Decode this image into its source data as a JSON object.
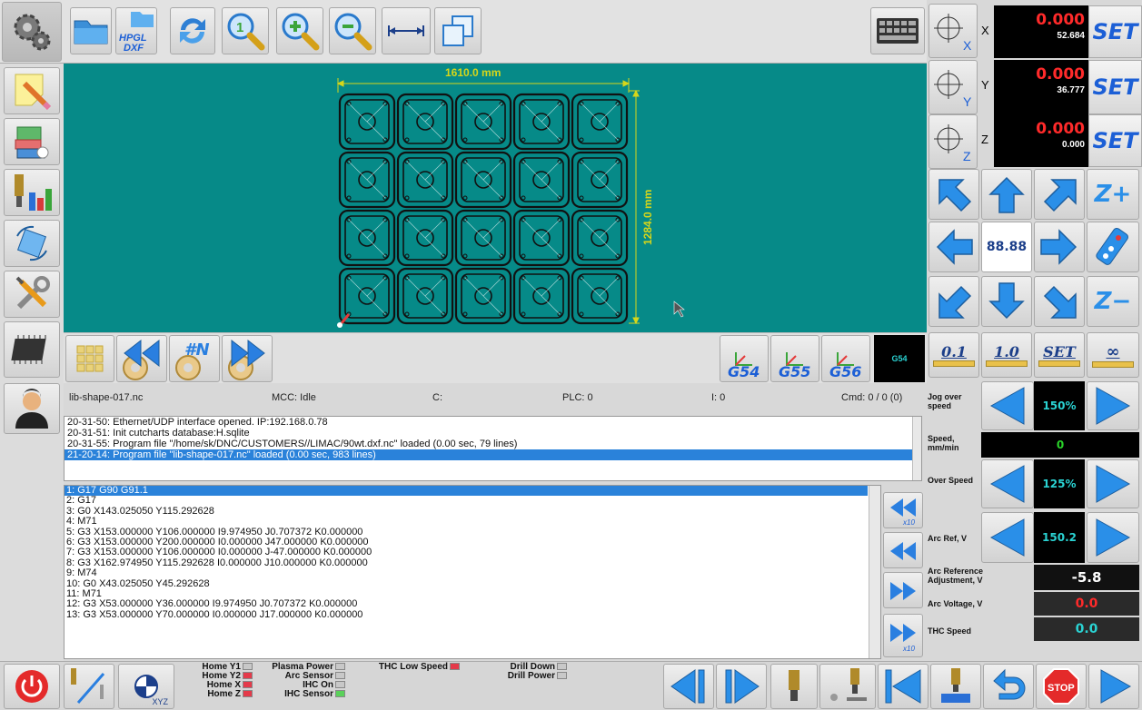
{
  "canvas": {
    "width_dim": "1610.0 mm",
    "height_dim": "1284.0 mm",
    "bg": "#068a88"
  },
  "toolbar": {
    "hpgl_label": "HPGL\nDXF"
  },
  "coords": {
    "active_wcs": "G54",
    "wcs_buttons": [
      "G54",
      "G55",
      "G56"
    ],
    "jump_label": "#N"
  },
  "status": {
    "file": "lib-shape-017.nc",
    "mcc": "MCC: Idle",
    "c": "C:",
    "plc": "PLC: 0",
    "i": "I: 0",
    "cmd": "Cmd: 0 / 0 (0)"
  },
  "log": [
    "20-31-50: Ethernet/UDP interface opened. IP:192.168.0.78",
    "20-31-51: Init cutcharts database:H.sqlite",
    "20-31-55: Program file \"/home/sk/DNC/CUSTOMERS//LIMAC/90wt.dxf.nc\" loaded (0.00 sec, 79 lines)",
    "21-20-14: Program file \"lib-shape-017.nc\" loaded (0.00 sec, 983 lines)"
  ],
  "code": [
    "1: G17 G90 G91.1",
    "2: G17",
    "3: G0 X143.025050 Y115.292628",
    "4: M71",
    "5: G3 X153.000000 Y106.000000 I9.974950 J0.707372 K0.000000",
    "6: G3 X153.000000 Y200.000000 I0.000000 J47.000000 K0.000000",
    "7: G3 X153.000000 Y106.000000 I0.000000 J-47.000000 K0.000000",
    "8: G3 X162.974950 Y115.292628 I0.000000 J10.000000 K0.000000",
    "9: M74",
    "10: G0 X43.025050 Y45.292628",
    "11: M71",
    "12: G3 X53.000000 Y36.000000 I9.974950 J0.707372 K0.000000",
    "13: G3 X53.000000 Y70.000000 I0.000000 J17.000000 K0.000000"
  ],
  "dro": {
    "x": {
      "axis": "X",
      "value": "0.000",
      "machine": "52.684"
    },
    "y": {
      "axis": "Y",
      "value": "0.000",
      "machine": "36.777"
    },
    "z": {
      "axis": "Z",
      "value": "0.000",
      "machine": "0.000"
    },
    "set_label": "SET"
  },
  "jog": {
    "feed": "88.88",
    "z_plus": "Z+",
    "z_minus": "Z−",
    "steps": [
      "0.1",
      "1.0",
      "SET",
      "∞"
    ]
  },
  "params": {
    "jog_over_speed": {
      "label": "Jog over speed",
      "value": "150%"
    },
    "speed": {
      "label": "Speed, mm/min",
      "value": "0"
    },
    "over_speed": {
      "label": "Over Speed",
      "value": "125%"
    },
    "arc_ref": {
      "label": "Arc Ref, V",
      "value": "150.2"
    },
    "arc_ref_adj": {
      "label": "Arc Reference Adjustment, V",
      "value": "-5.8"
    },
    "arc_voltage": {
      "label": "Arc Voltage, V",
      "value": "0.0"
    },
    "thc_speed": {
      "label": "THC Speed",
      "value": "0.0"
    }
  },
  "io": {
    "col1": [
      "Home Y1",
      "Home Y2",
      "Home X",
      "Home Z"
    ],
    "col2": [
      "Plasma Power",
      "Arc Sensor",
      "IHC On",
      "IHC Sensor"
    ],
    "thc_low": "THC Low Speed",
    "col4": [
      "Drill Down",
      "Drill Power"
    ],
    "xyz": "XYZ",
    "stop": "STOP"
  }
}
